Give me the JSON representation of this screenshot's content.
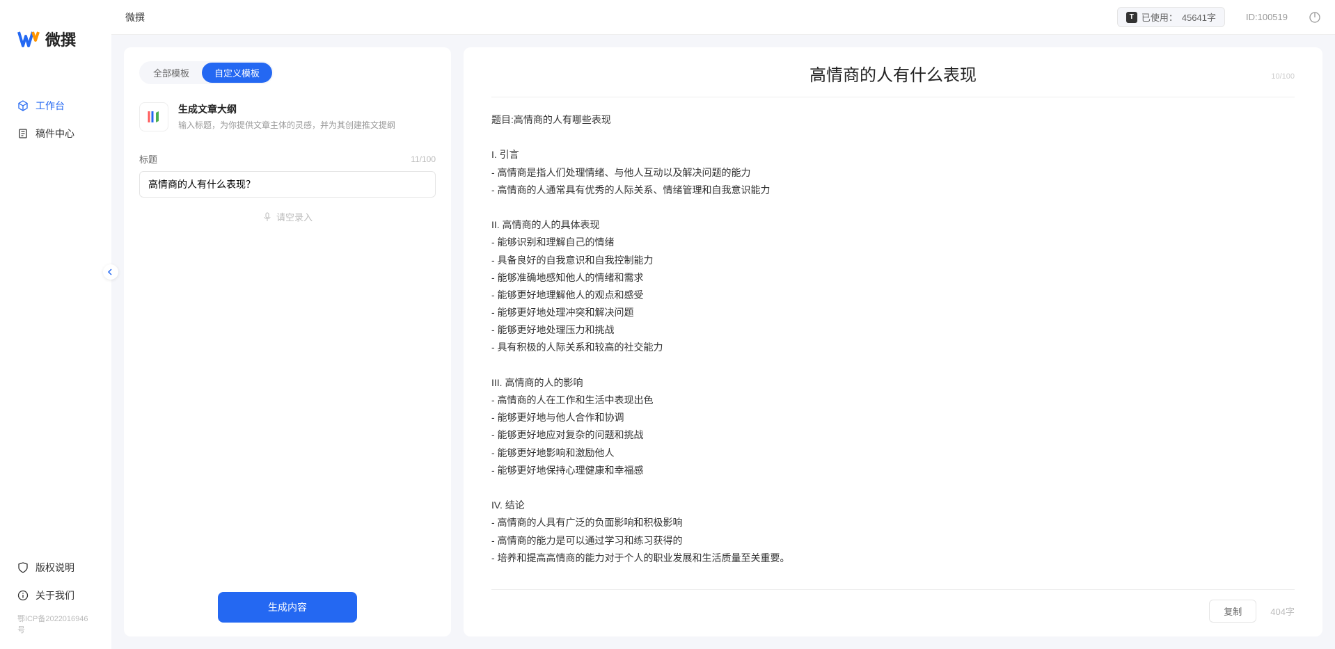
{
  "app_name": "微撰",
  "sidebar": {
    "logo_text": "微撰",
    "nav": [
      {
        "label": "工作台",
        "active": true
      },
      {
        "label": "稿件中心",
        "active": false
      }
    ],
    "bottom": [
      {
        "label": "版权说明"
      },
      {
        "label": "关于我们"
      }
    ],
    "icp": "鄂ICP备2022016946号"
  },
  "topbar": {
    "title": "微撰",
    "usage_prefix": "已使用：",
    "usage_value": "45641字",
    "id_label": "ID:100519",
    "t_badge": "T"
  },
  "left": {
    "tabs": [
      {
        "label": "全部模板",
        "active": false
      },
      {
        "label": "自定义模板",
        "active": true
      }
    ],
    "template": {
      "title": "生成文章大纲",
      "desc": "输入标题，为你提供文章主体的灵感，并为其创建推文提纲"
    },
    "form": {
      "label": "标题",
      "count": "11/100",
      "value": "高情商的人有什么表现？",
      "voice_hint": "请空录入"
    },
    "generate_label": "生成内容"
  },
  "right": {
    "title": "高情商的人有什么表现",
    "title_count": "10/100",
    "body": "题目:高情商的人有哪些表现\n\nI. 引言\n- 高情商是指人们处理情绪、与他人互动以及解决问题的能力\n- 高情商的人通常具有优秀的人际关系、情绪管理和自我意识能力\n\nII. 高情商的人的具体表现\n- 能够识别和理解自己的情绪\n- 具备良好的自我意识和自我控制能力\n- 能够准确地感知他人的情绪和需求\n- 能够更好地理解他人的观点和感受\n- 能够更好地处理冲突和解决问题\n- 能够更好地处理压力和挑战\n- 具有积极的人际关系和较高的社交能力\n\nIII. 高情商的人的影响\n- 高情商的人在工作和生活中表现出色\n- 能够更好地与他人合作和协调\n- 能够更好地应对复杂的问题和挑战\n- 能够更好地影响和激励他人\n- 能够更好地保持心理健康和幸福感\n\nIV. 结论\n- 高情商的人具有广泛的负面影响和积极影响\n- 高情商的能力是可以通过学习和练习获得的\n- 培养和提高高情商的能力对于个人的职业发展和生活质量至关重要。",
    "copy_label": "复制",
    "word_count": "404字"
  }
}
